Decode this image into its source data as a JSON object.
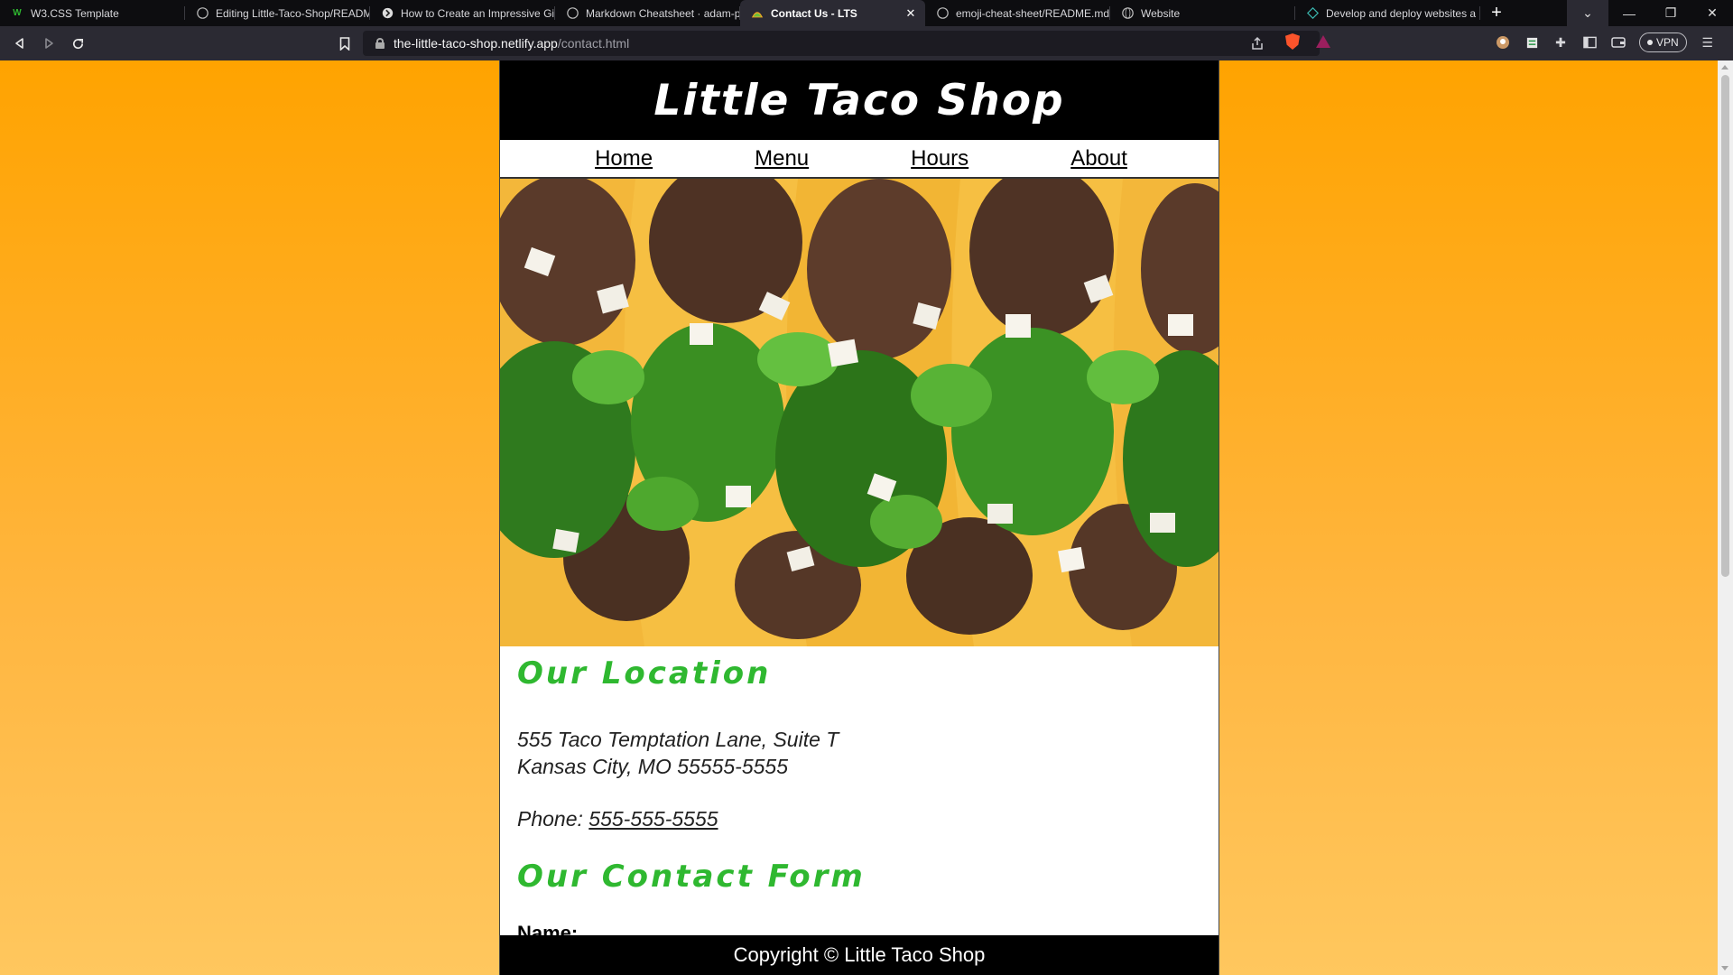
{
  "browser": {
    "tabs": [
      {
        "title": "W3.CSS Template",
        "icon": "w3-logo-icon",
        "active": false
      },
      {
        "title": "Editing Little-Taco-Shop/READM",
        "icon": "github-icon",
        "active": false
      },
      {
        "title": "How to Create an Impressive Gi",
        "icon": "article-icon",
        "active": false
      },
      {
        "title": "Markdown Cheatsheet · adam-p",
        "icon": "github-icon",
        "active": false
      },
      {
        "title": "Contact Us - LTS",
        "icon": "taco-icon",
        "active": true
      },
      {
        "title": "emoji-cheat-sheet/README.md",
        "icon": "github-icon",
        "active": false
      },
      {
        "title": "Website",
        "icon": "globe-icon",
        "active": false
      },
      {
        "title": "Develop and deploy websites a",
        "icon": "netlify-icon",
        "active": false
      }
    ],
    "url_host": "the-little-taco-shop.netlify.app",
    "url_path": "/contact.html",
    "vpn_label": "VPN"
  },
  "site": {
    "title": "Little Taco Shop",
    "nav": [
      "Home",
      "Menu",
      "Hours",
      "About"
    ],
    "location_heading": "Our Location",
    "address_line1": "555 Taco Temptation Lane, Suite T",
    "address_line2": "Kansas City, MO 55555-5555",
    "phone_label": "Phone:",
    "phone_number": "555-555-5555",
    "form_heading": "Our Contact Form",
    "name_label": "Name:",
    "footer": "Copyright © Little Taco Shop"
  },
  "colors": {
    "page_gradient_top": "#ffa300",
    "page_gradient_bottom": "#ffc75e",
    "heading_green": "#2fb830",
    "header_black": "#000000"
  }
}
